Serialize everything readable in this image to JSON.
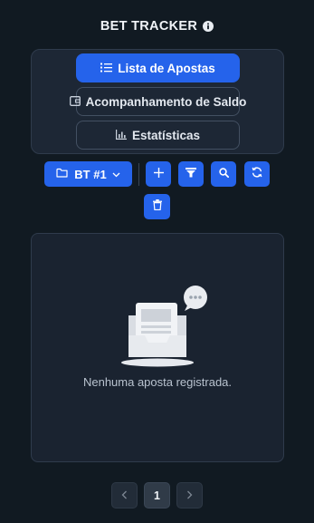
{
  "header": {
    "title": "BET TRACKER",
    "info_icon": "info-icon"
  },
  "nav": {
    "items": [
      {
        "label": "Lista de Apostas",
        "icon": "list-icon",
        "active": true
      },
      {
        "label": "Acompanhamento de Saldo",
        "icon": "wallet-icon",
        "active": false
      },
      {
        "label": "Estatísticas",
        "icon": "bar-chart-icon",
        "active": false
      }
    ]
  },
  "toolbar": {
    "wallet_select": {
      "value": "BT #1",
      "icon": "folder-icon"
    },
    "actions": [
      {
        "icon": "plus-icon"
      },
      {
        "icon": "filter-icon"
      },
      {
        "icon": "search-icon"
      },
      {
        "icon": "refresh-icon"
      },
      {
        "icon": "trash-icon"
      }
    ]
  },
  "empty_state": {
    "message": "Nenhuma aposta registrada."
  },
  "pagination": {
    "current_page": "1"
  },
  "colors": {
    "background": "#111a22",
    "panel": "#1d2735",
    "accent": "#2563eb",
    "text_muted": "#b9c3cf"
  }
}
